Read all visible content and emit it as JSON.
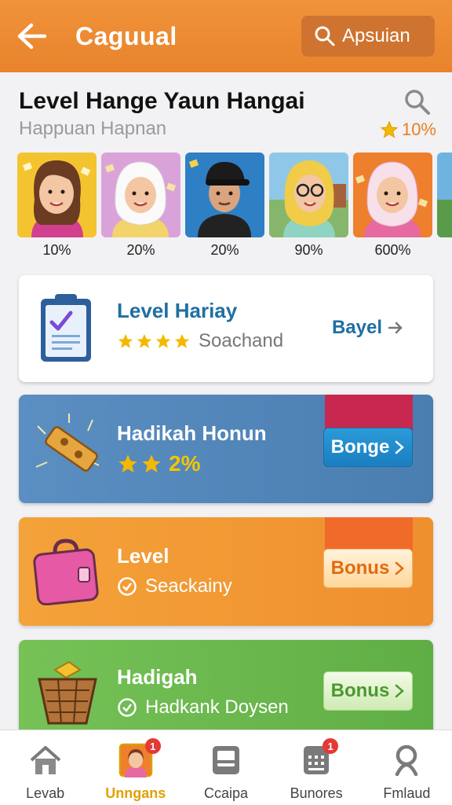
{
  "header": {
    "title": "Caguual",
    "search_label": "Apsuian",
    "back_icon": "back-arrow-icon"
  },
  "section": {
    "title": "Level Hange Yaun Hangai",
    "subtitle": "Happuan Hapnan",
    "rating": "10%"
  },
  "avatars": [
    {
      "percent": "10%",
      "bg": "#f4c430"
    },
    {
      "percent": "20%",
      "bg": "#d9a3d9"
    },
    {
      "percent": "20%",
      "bg": "#2f7fc4"
    },
    {
      "percent": "90%",
      "bg": "#8fc7e8"
    },
    {
      "percent": "600%",
      "bg": "#ee7f2d"
    }
  ],
  "cards": [
    {
      "title": "Level Hariay",
      "subtitle": "Soachand",
      "action": "Bayel",
      "stars": 4,
      "theme": "white"
    },
    {
      "title": "Hadikah Honun",
      "subtitle": "2%",
      "action": "Bonge",
      "stars": 2,
      "theme": "blue"
    },
    {
      "title": "Level",
      "subtitle": "Seackainy",
      "action": "Bonus",
      "theme": "orange"
    },
    {
      "title": "Hadigah",
      "subtitle": "Hadkank Doysen",
      "action": "Bonus",
      "theme": "green"
    }
  ],
  "nav": [
    {
      "label": "Levab",
      "icon": "home-icon"
    },
    {
      "label": "Unngans",
      "icon": "avatar-icon",
      "badge": "1",
      "active": true
    },
    {
      "label": "Ccaipa",
      "icon": "tablet-icon"
    },
    {
      "label": "Bunores",
      "icon": "calculator-icon",
      "badge": "1"
    },
    {
      "label": "Fmlaud",
      "icon": "profile-icon"
    }
  ],
  "colors": {
    "brand_orange": "#ee8a33",
    "card_blue": "#4f84b6",
    "card_orange": "#f29a35",
    "card_green": "#6bb84f",
    "link_blue": "#1f6fa3",
    "active_nav": "#e0a000"
  }
}
